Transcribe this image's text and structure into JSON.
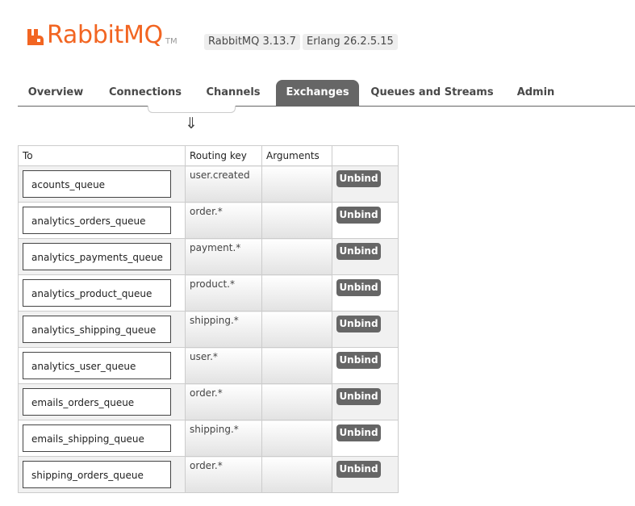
{
  "header": {
    "logo_text": "RabbitMQ",
    "logo_tm": "TM",
    "version_rabbit": "RabbitMQ 3.13.7",
    "version_erlang": "Erlang 26.2.5.15",
    "brand_color": "#f26522"
  },
  "nav": {
    "tabs": [
      "Overview",
      "Connections",
      "Channels",
      "Exchanges",
      "Queues and Streams",
      "Admin"
    ],
    "active": "Exchanges"
  },
  "arrow": "⇓",
  "table": {
    "headers": {
      "to": "To",
      "routing_key": "Routing key",
      "arguments": "Arguments"
    },
    "action_label": "Unbind",
    "rows": [
      {
        "to": "acounts_queue",
        "routing_key": "user.created",
        "arguments": ""
      },
      {
        "to": "analytics_orders_queue",
        "routing_key": "order.*",
        "arguments": ""
      },
      {
        "to": "analytics_payments_queue",
        "routing_key": "payment.*",
        "arguments": ""
      },
      {
        "to": "analytics_product_queue",
        "routing_key": "product.*",
        "arguments": ""
      },
      {
        "to": "analytics_shipping_queue",
        "routing_key": "shipping.*",
        "arguments": ""
      },
      {
        "to": "analytics_user_queue",
        "routing_key": "user.*",
        "arguments": ""
      },
      {
        "to": "emails_orders_queue",
        "routing_key": "order.*",
        "arguments": ""
      },
      {
        "to": "emails_shipping_queue",
        "routing_key": "shipping.*",
        "arguments": ""
      },
      {
        "to": "shipping_orders_queue",
        "routing_key": "order.*",
        "arguments": ""
      }
    ]
  }
}
